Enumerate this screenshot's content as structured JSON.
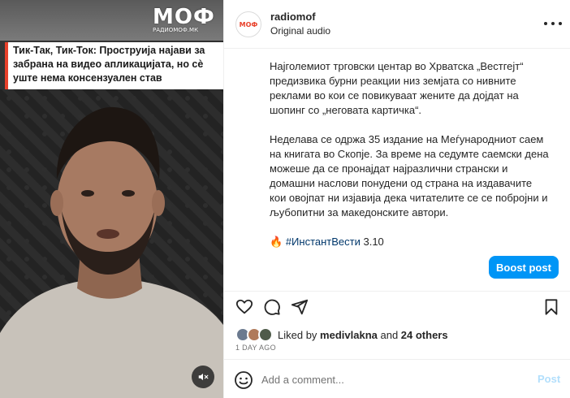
{
  "media": {
    "headline": "Тик-Так, Тик-Ток: Проструија најави за забрана на видео апликацијата, но сè уште нема консензуален став",
    "watermark_text": "МОФ",
    "watermark_sub": "РАДИОМОФ.МК",
    "mute_icon": "speaker-muted-icon"
  },
  "header": {
    "username": "radiomof",
    "audio": "Original audio",
    "avatar_text": "МОФ",
    "more_icon": "more-options-icon"
  },
  "caption": {
    "paragraph1": "Најголемиот трговски центар во Хрватска „Вестгејт“ предизвика бурни реакции низ земјата со нивните реклами во кои се повикуваат жените да дојдат на шопинг со „неговата картичка“.",
    "paragraph2": "Неделава се одржа 35 издание на Меѓународниот саем на книгата во Скопје. За време на седумте саемски дена можеше да се пронајдат најразлични странски и домашни наслови понудени од страна на издавачите кои овојпат ни изјавија дека читателите се се побројни и љубопитни за македонските автори.",
    "fire_emoji": "🔥",
    "hashtag": "#ИнстантВести",
    "date_suffix": " 3.10"
  },
  "boost_label": "Boost post",
  "actions": {
    "like_icon": "heart-icon",
    "comment_icon": "comment-icon",
    "share_icon": "share-icon",
    "save_icon": "bookmark-icon"
  },
  "likes": {
    "prefix": "Liked by ",
    "user": "medivlakna",
    "middle": " and ",
    "others": "24 others"
  },
  "time": "1 DAY AGO",
  "comment": {
    "placeholder": "Add a comment...",
    "post_label": "Post",
    "emoji_icon": "emoji-smile-icon"
  },
  "colors": {
    "accent": "#0095f6",
    "link": "#00376b",
    "brand": "#e8412b"
  }
}
